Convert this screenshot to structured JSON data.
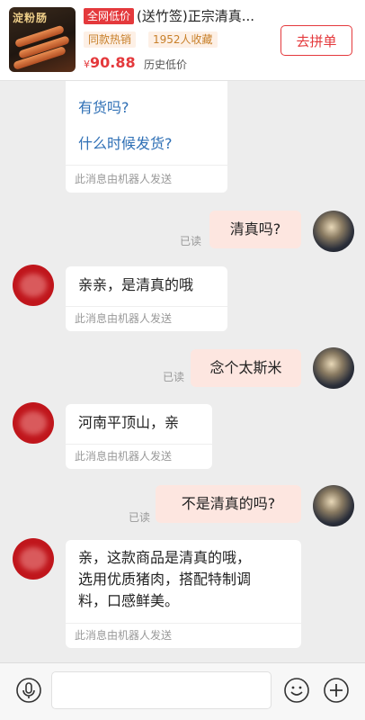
{
  "product": {
    "thumb_title": "淀粉肠",
    "tag": "全网低价",
    "title": "(送竹签)正宗清真...",
    "tags": [
      "同款热销",
      "1952人收藏"
    ],
    "currency": "¥",
    "price": "90.88",
    "history_label": "历史低价",
    "join_button": "去拼单"
  },
  "messages": {
    "m1": {
      "links": [
        "有货吗?",
        "什么时候发货?"
      ],
      "robot": "此消息由机器人发送"
    },
    "m2": {
      "text": "清真吗?",
      "read": "已读"
    },
    "m3": {
      "text": "亲亲，是清真的哦",
      "robot": "此消息由机器人发送"
    },
    "m4": {
      "text": "念个太斯米",
      "read": "已读"
    },
    "m5": {
      "text": "河南平顶山，亲",
      "robot": "此消息由机器人发送"
    },
    "m6": {
      "text": "不是清真的吗?",
      "read": "已读"
    },
    "m7": {
      "lines": [
        "亲，这款商品是清真的哦，",
        "选用优质猪肉，搭配特制调",
        "料，口感鲜美。"
      ],
      "robot": "此消息由机器人发送"
    }
  },
  "footer": {
    "icons": [
      "voice-icon",
      "emoji-icon",
      "plus-icon"
    ]
  }
}
